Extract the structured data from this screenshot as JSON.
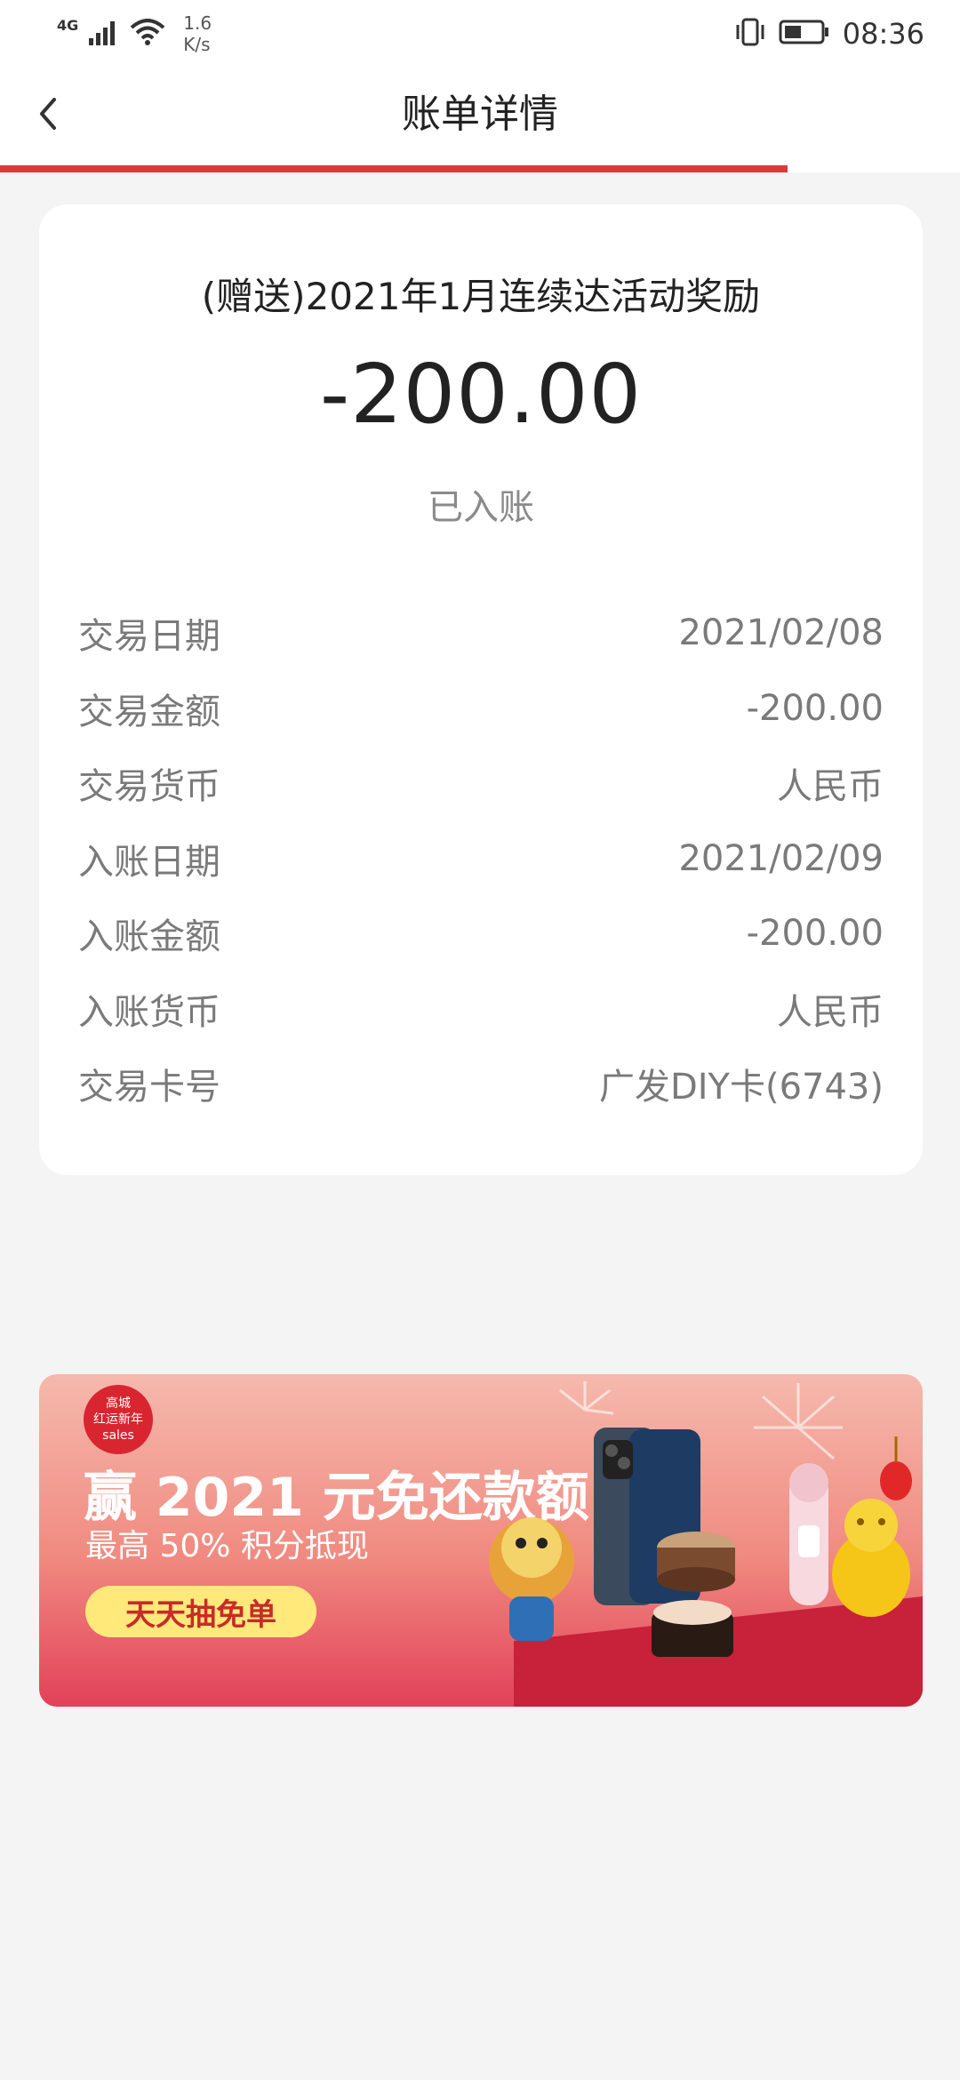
{
  "status_bar": {
    "network": "4G",
    "speed_value": "1.6",
    "speed_unit": "K/s",
    "time": "08:36"
  },
  "header": {
    "title": "账单详情",
    "progress": 0.82
  },
  "transaction": {
    "title": "(赠送)2021年1月连续达活动奖励",
    "amount": "-200.00",
    "status": "已入账",
    "details": [
      {
        "label": "交易日期",
        "value": "2021/02/08"
      },
      {
        "label": "交易金额",
        "value": "-200.00"
      },
      {
        "label": "交易货币",
        "value": "人民币"
      },
      {
        "label": "入账日期",
        "value": "2021/02/09"
      },
      {
        "label": "入账金额",
        "value": "-200.00"
      },
      {
        "label": "入账货币",
        "value": "人民币"
      },
      {
        "label": "交易卡号",
        "value": "广发DIY卡(6743)"
      }
    ]
  },
  "banner": {
    "logo_line1": "高城",
    "logo_line2": "红运新年",
    "logo_line3": "sales",
    "headline": "赢 2021 元免还款额",
    "subtitle": "最高 50% 积分抵现",
    "cta": "天天抽免单"
  }
}
